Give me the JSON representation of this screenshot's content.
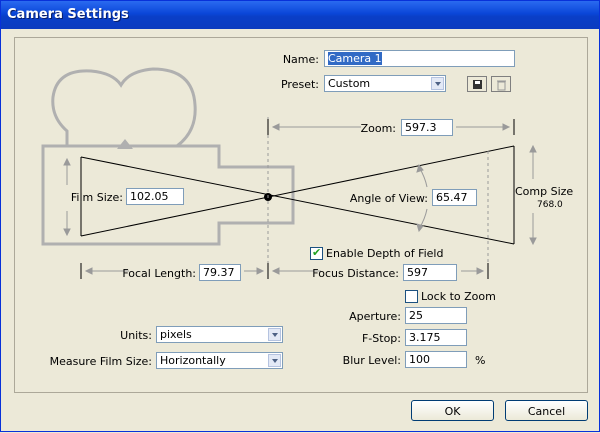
{
  "window": {
    "title": "Camera Settings"
  },
  "name": {
    "label": "Name:",
    "value": "Camera 1"
  },
  "preset": {
    "label": "Preset:",
    "value": "Custom"
  },
  "zoom": {
    "label": "Zoom:",
    "value": "597.3"
  },
  "film_size": {
    "label": "Film Size:",
    "value": "102.05"
  },
  "angle_of_view": {
    "label": "Angle of View:",
    "value": "65.47"
  },
  "comp_size": {
    "label": "Comp Size",
    "value": "768.0"
  },
  "depth_of_field": {
    "label": "Enable Depth of Field",
    "checked": true
  },
  "focal_length": {
    "label": "Focal Length:",
    "value": "79.37"
  },
  "focus_distance": {
    "label": "Focus Distance:",
    "value": "597"
  },
  "lock_to_zoom": {
    "label": "Lock to Zoom",
    "checked": false
  },
  "aperture": {
    "label": "Aperture:",
    "value": "25"
  },
  "fstop": {
    "label": "F-Stop:",
    "value": "3.175"
  },
  "blur_level": {
    "label": "Blur Level:",
    "value": "100",
    "unit": "%"
  },
  "units": {
    "label": "Units:",
    "value": "pixels"
  },
  "measure_film_size": {
    "label": "Measure Film Size:",
    "value": "Horizontally"
  },
  "buttons": {
    "ok": "OK",
    "cancel": "Cancel"
  },
  "icons": {
    "save": "save-disk-icon",
    "delete": "trash-icon"
  }
}
